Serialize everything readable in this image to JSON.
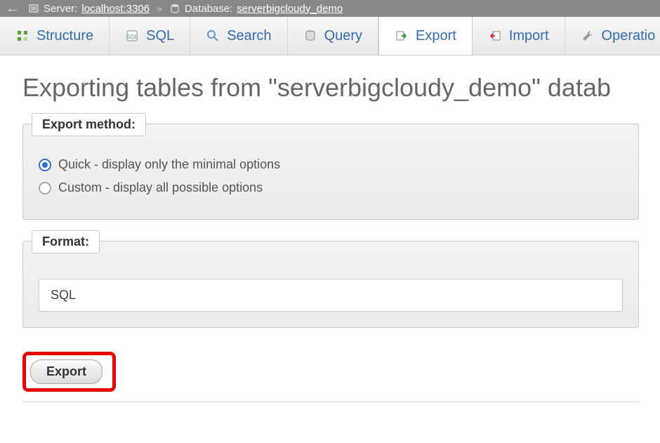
{
  "breadcrumb": {
    "server_label": "Server:",
    "server_value": "localhost:3306",
    "database_label": "Database:",
    "database_value": "serverbigcloudy_demo"
  },
  "tabs": {
    "structure": "Structure",
    "sql": "SQL",
    "search": "Search",
    "query": "Query",
    "export": "Export",
    "import": "Import",
    "operations": "Operatio"
  },
  "page_title": "Exporting tables from \"serverbigcloudy_demo\" datab",
  "export_method": {
    "legend": "Export method:",
    "quick_label": "Quick - display only the minimal options",
    "custom_label": "Custom - display all possible options",
    "selected": "quick"
  },
  "format": {
    "legend": "Format:",
    "value": "SQL"
  },
  "buttons": {
    "export": "Export"
  }
}
